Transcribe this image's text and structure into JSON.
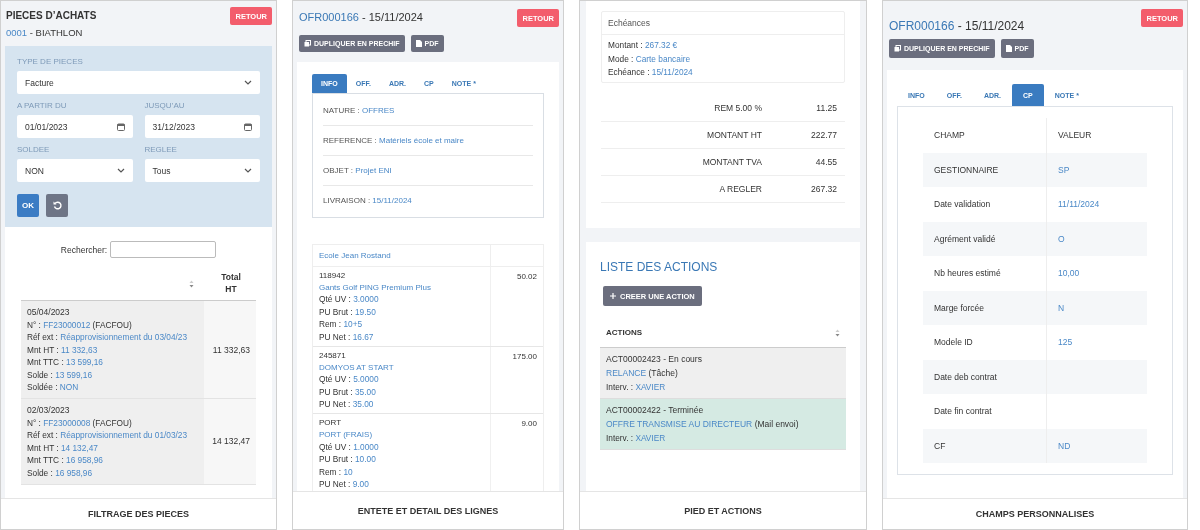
{
  "filter_panel": {
    "title": "PIECES D’ACHATS",
    "code": "0001",
    "subtitle": " - BIATHLON",
    "back_button": "RETOUR",
    "fields": [
      {
        "label": "TYPE DE PIECES",
        "value": "Facture",
        "kind": "select",
        "wide": true
      },
      {
        "label": "A PARTIR DU",
        "value": "01/01/2023",
        "kind": "date",
        "wide": false
      },
      {
        "label": "JUSQU’AU",
        "value": "31/12/2023",
        "kind": "date",
        "wide": false
      },
      {
        "label": "SOLDEE",
        "value": "NON",
        "kind": "select",
        "wide": false
      },
      {
        "label": "REGLEE",
        "value": "Tous",
        "kind": "select",
        "wide": false
      }
    ],
    "ok_button": "OK",
    "search_label": "Rechercher:",
    "total_column": "Total HT",
    "rows": [
      {
        "date": "05/04/2023",
        "lines": [
          {
            "label": "N° :",
            "value": "FF23000012",
            "suffix": "(FACFOU)"
          },
          {
            "label": "Réf ext :",
            "value": "Réapprovisionnement du 03/04/23"
          },
          {
            "label": "Mnt HT :",
            "value": "11 332,63"
          },
          {
            "label": "Mnt TTC :",
            "value": "13 599,16"
          },
          {
            "label": "Solde :",
            "value": "13 599,16"
          },
          {
            "label": "Soldée :",
            "value": "NON"
          }
        ],
        "total": "11 332,63"
      },
      {
        "date": "02/03/2023",
        "lines": [
          {
            "label": "N° :",
            "value": "FF23000008",
            "suffix": "(FACFOU)"
          },
          {
            "label": "Réf ext :",
            "value": "Réapprovisionnement du 01/03/23"
          },
          {
            "label": "Mnt HT :",
            "value": "14 132,47"
          },
          {
            "label": "Mnt TTC :",
            "value": "16 958,96"
          },
          {
            "label": "Solde :",
            "value": "16 958,96"
          }
        ],
        "total": "14 132,47"
      }
    ],
    "caption": "FILTRAGE DES PIECES"
  },
  "header_panel": {
    "code": "OFR000166",
    "suffix": " - 15/11/2024",
    "back_button": "RETOUR",
    "actions": [
      {
        "label": "DUPLIQUER EN PRECHIF",
        "kind": "copy"
      },
      {
        "label": "PDF",
        "kind": "file"
      }
    ],
    "tabs": [
      {
        "label": "INFO",
        "selected": true
      },
      {
        "label": "OFF.",
        "selected": false
      },
      {
        "label": "ADR.",
        "selected": false
      },
      {
        "label": "CP",
        "selected": false
      },
      {
        "label": "NOTE *",
        "selected": false
      }
    ],
    "info": [
      {
        "label": "NATURE :",
        "value": "OFFRES"
      },
      {
        "label": "REFERENCE :",
        "value": "Matériels école et maire"
      },
      {
        "label": "OBJET :",
        "value": "Projet ENI"
      },
      {
        "label": "LIVRAISON :",
        "value": "15/11/2024"
      }
    ],
    "group": "Ecole Jean Rostand",
    "items": [
      {
        "code": "118942",
        "name": "Gants Golf PING Premium Plus",
        "details": [
          {
            "label": "Qté UV :",
            "value": "3.0000"
          },
          {
            "label": "PU Brut :",
            "value": "19.50"
          },
          {
            "label": "Rem :",
            "value": "10+5"
          },
          {
            "label": "PU Net :",
            "value": "16.67"
          }
        ],
        "amount": "50.02"
      },
      {
        "code": "245871",
        "name": "DOMYOS AT START",
        "details": [
          {
            "label": "Qté UV :",
            "value": "5.0000"
          },
          {
            "label": "PU Brut :",
            "value": "35.00"
          },
          {
            "label": "PU Net :",
            "value": "35.00"
          }
        ],
        "amount": "175.00"
      },
      {
        "code": "PORT",
        "name": "PORT (FRAIS)",
        "details": [
          {
            "label": "Qté UV :",
            "value": "1.0000"
          },
          {
            "label": "PU Brut :",
            "value": "10.00"
          },
          {
            "label": "Rem :",
            "value": "10"
          },
          {
            "label": "PU Net :",
            "value": "9.00"
          }
        ],
        "amount": "9.00"
      }
    ],
    "caption": "ENTETE ET DETAIL DES LIGNES"
  },
  "footer_panel": {
    "schedule": {
      "title": "Echéances",
      "lines": [
        {
          "label": "Montant :",
          "value": "267.32 €"
        },
        {
          "label": "Mode :",
          "value": "Carte bancaire"
        },
        {
          "label": "Echéance :",
          "value": "15/11/2024"
        }
      ]
    },
    "totals": [
      {
        "label": "REM 5.00 %",
        "value": "11.25"
      },
      {
        "label": "MONTANT HT",
        "value": "222.77"
      },
      {
        "label": "MONTANT TVA",
        "value": "44.55"
      },
      {
        "label": "A REGLER",
        "value": "267.32"
      }
    ],
    "actions_title": "LISTE DES ACTIONS",
    "create_button": "CREER UNE ACTION",
    "actions_column": "ACTIONS",
    "actions": [
      {
        "kind": "in_progress",
        "title": "ACT00002423 - En cours",
        "type": "RELANCE",
        "type_note": "(Tâche)",
        "agent_label": "Interv. :",
        "agent": "XAVIER"
      },
      {
        "kind": "done",
        "title": "ACT00002422 - Terminée",
        "type": "OFFRE TRANSMISE AU DIRECTEUR",
        "type_note": "(Mail envoi)",
        "agent_label": "Interv. :",
        "agent": "XAVIER"
      }
    ],
    "caption": "PIED ET ACTIONS"
  },
  "custom_fields_panel": {
    "code": "OFR000166",
    "suffix": " - 15/11/2024",
    "back_button": "RETOUR",
    "actions": [
      {
        "label": "DUPLIQUER EN PRECHIF",
        "kind": "copy"
      },
      {
        "label": "PDF",
        "kind": "file"
      }
    ],
    "tabs": [
      {
        "label": "INFO",
        "selected": false
      },
      {
        "label": "OFF.",
        "selected": false
      },
      {
        "label": "ADR.",
        "selected": false
      },
      {
        "label": "CP",
        "selected": true
      },
      {
        "label": "NOTE *",
        "selected": false
      }
    ],
    "columns": [
      "CHAMP",
      "VALEUR"
    ],
    "rows": [
      {
        "field": "GESTIONNAIRE",
        "value": "SP"
      },
      {
        "field": "Date validation",
        "value": "11/11/2024"
      },
      {
        "field": "Agrément validé",
        "value": "O"
      },
      {
        "field": "Nb heures estimé",
        "value": "10,00"
      },
      {
        "field": "Marge forcée",
        "value": "N"
      },
      {
        "field": "Modele ID",
        "value": "125"
      },
      {
        "field": "Date deb contrat"
      },
      {
        "field": "Date fin contrat"
      },
      {
        "field": "CF",
        "value": "ND"
      }
    ],
    "caption": "CHAMPS PERSONNALISES"
  }
}
